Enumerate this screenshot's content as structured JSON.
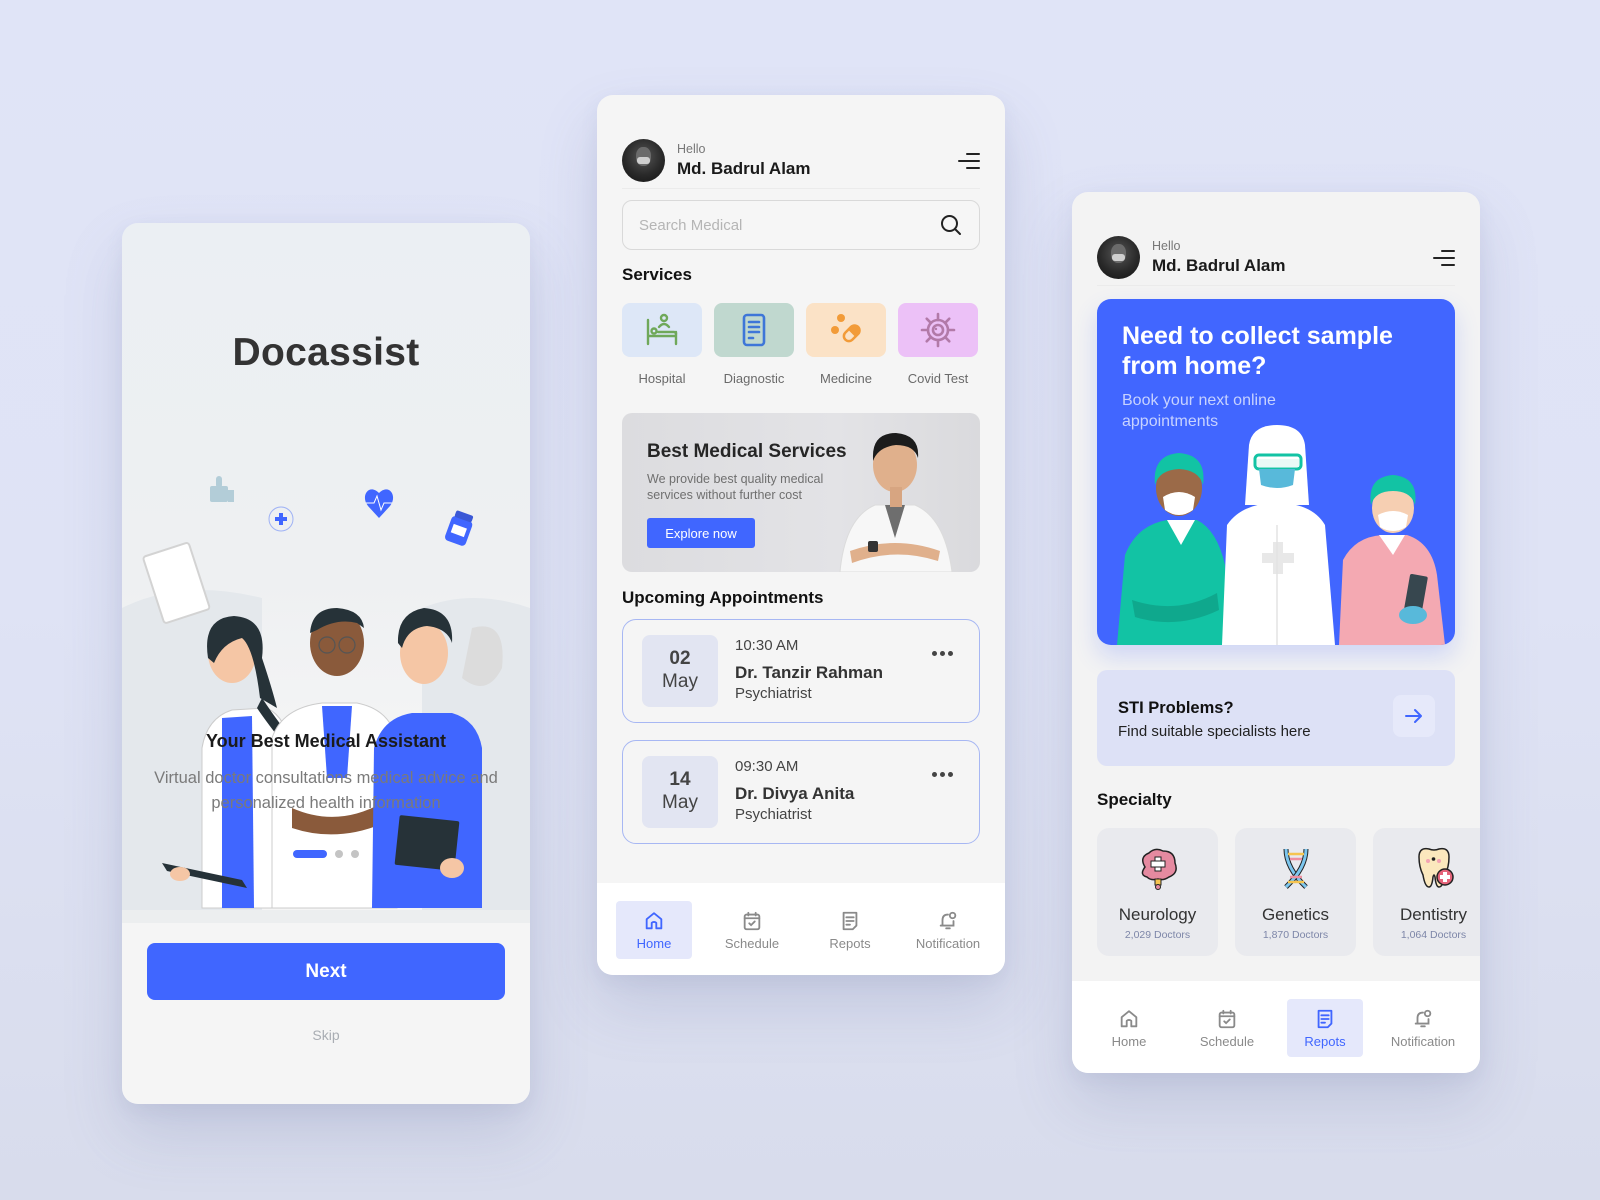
{
  "onboarding": {
    "app_title": "Docassist",
    "heading": "Your Best Medical Assistant",
    "description": "Virtual doctor consultations medical advice and personalized health information",
    "pagination": {
      "current": 1,
      "total": 3
    },
    "next_label": "Next",
    "skip_label": "Skip"
  },
  "home": {
    "greeting": "Hello",
    "user_name": "Md. Badrul Alam",
    "search": {
      "placeholder": "Search Medical",
      "value": ""
    },
    "services_title": "Services",
    "services": [
      {
        "label": "Hospital",
        "icon": "hospital-bed-icon",
        "bg": "#dde7f7",
        "color": "#6fa85a"
      },
      {
        "label": "Diagnostic",
        "icon": "clipboard-report-icon",
        "bg": "#c0d8cf",
        "color": "#3e76d8"
      },
      {
        "label": "Medicine",
        "icon": "pills-icon",
        "bg": "#fbe2c6",
        "color": "#f29b38"
      },
      {
        "label": "Covid Test",
        "icon": "virus-icon",
        "bg": "#ecc1f7",
        "color": "#b27aa8"
      }
    ],
    "banner": {
      "title": "Best Medical Services",
      "text": "We  provide best quality medical services without further cost",
      "button": "Explore now"
    },
    "appointments_title": "Upcoming Appointments",
    "appointments": [
      {
        "day": "02",
        "month": "May",
        "time": "10:30 AM",
        "doctor": "Dr. Tanzir Rahman",
        "specialty": "Psychiatrist"
      },
      {
        "day": "14",
        "month": "May",
        "time": "09:30 AM",
        "doctor": "Dr. Divya Anita",
        "specialty": "Psychiatrist"
      }
    ],
    "tabs": [
      {
        "label": "Home",
        "icon": "home-icon",
        "active": true
      },
      {
        "label": "Schedule",
        "icon": "calendar-check-icon",
        "active": false
      },
      {
        "label": "Repots",
        "icon": "report-icon",
        "active": false
      },
      {
        "label": "Notification",
        "icon": "bell-icon",
        "active": false
      }
    ]
  },
  "specialty_screen": {
    "greeting": "Hello",
    "user_name": "Md. Badrul Alam",
    "hero": {
      "title": "Need to collect sample from home?",
      "subtitle": "Book your next online appointments"
    },
    "sti": {
      "title": "STI Problems?",
      "subtitle": "Find suitable specialists here"
    },
    "specialty_title": "Specialty",
    "specialties": [
      {
        "name": "Neurology",
        "count": "2,029 Doctors",
        "icon": "brain-icon"
      },
      {
        "name": "Genetics",
        "count": "1,870 Doctors",
        "icon": "dna-icon"
      },
      {
        "name": "Dentistry",
        "count": "1,064 Doctors",
        "icon": "tooth-icon"
      }
    ],
    "tabs": [
      {
        "label": "Home",
        "icon": "home-icon",
        "active": false
      },
      {
        "label": "Schedule",
        "icon": "calendar-check-icon",
        "active": false
      },
      {
        "label": "Repots",
        "icon": "report-icon",
        "active": true
      },
      {
        "label": "Notification",
        "icon": "bell-icon",
        "active": false
      }
    ]
  },
  "colors": {
    "accent": "#4066ff",
    "background": "#e0e4f7",
    "appointment_border": "#a7b7f3"
  }
}
